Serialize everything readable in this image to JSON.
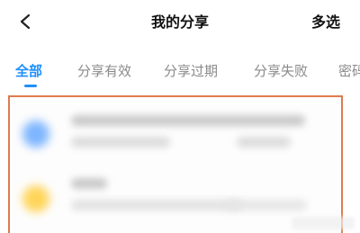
{
  "header": {
    "title": "我的分享",
    "back_icon": "chevron-left-icon",
    "multi_select_label": "多选"
  },
  "tabs": [
    {
      "label": "全部",
      "active": true
    },
    {
      "label": "分享有效",
      "active": false
    },
    {
      "label": "分享过期",
      "active": false
    },
    {
      "label": "分享失败",
      "active": false
    },
    {
      "label": "密码",
      "active": false
    }
  ],
  "colors": {
    "accent": "#1e90ff",
    "highlight_border": "#e07a4e",
    "inactive_tab": "#8a8a8a"
  },
  "list": {
    "items": [
      {
        "icon": "blurred-file-icon-blue"
      },
      {
        "icon": "blurred-file-icon-yellow"
      }
    ]
  }
}
